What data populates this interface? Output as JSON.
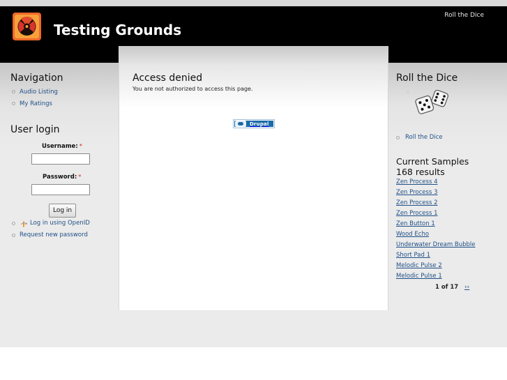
{
  "header": {
    "site_name": "Testing Grounds",
    "top_link": "Roll the Dice"
  },
  "main": {
    "title": "Access denied",
    "message": "You are not authorized to access this page.",
    "badge_label": "Drupal"
  },
  "navigation": {
    "title": "Navigation",
    "items": [
      "Audio Listing",
      "My Ratings"
    ]
  },
  "user_login": {
    "title": "User login",
    "username_label": "Username:",
    "password_label": "Password:",
    "required_mark": "*",
    "username_value": "",
    "password_value": "",
    "login_button": "Log in",
    "links": [
      "Log in using OpenID",
      "Request new password"
    ]
  },
  "roll_dice": {
    "title": "Roll the Dice",
    "link": "Roll the Dice"
  },
  "samples": {
    "title": "Current Samples",
    "count": "168 results",
    "items": [
      "Zen Process 4",
      "Zen Process 3",
      "Zen Process 2",
      "Zen Process 1",
      "Zen Button 1",
      "Wood Echo",
      "Underwater Dream Bubble",
      "Short Pad 1",
      "Melodic Pulse 2",
      "Melodic Pulse 1"
    ],
    "pager": "1 of 17",
    "next_label": "››"
  },
  "colors": {
    "link": "#1f4f87",
    "header_bg": "#000000",
    "required": "#d4554b",
    "drupal_blue": "#1c6ba8"
  }
}
